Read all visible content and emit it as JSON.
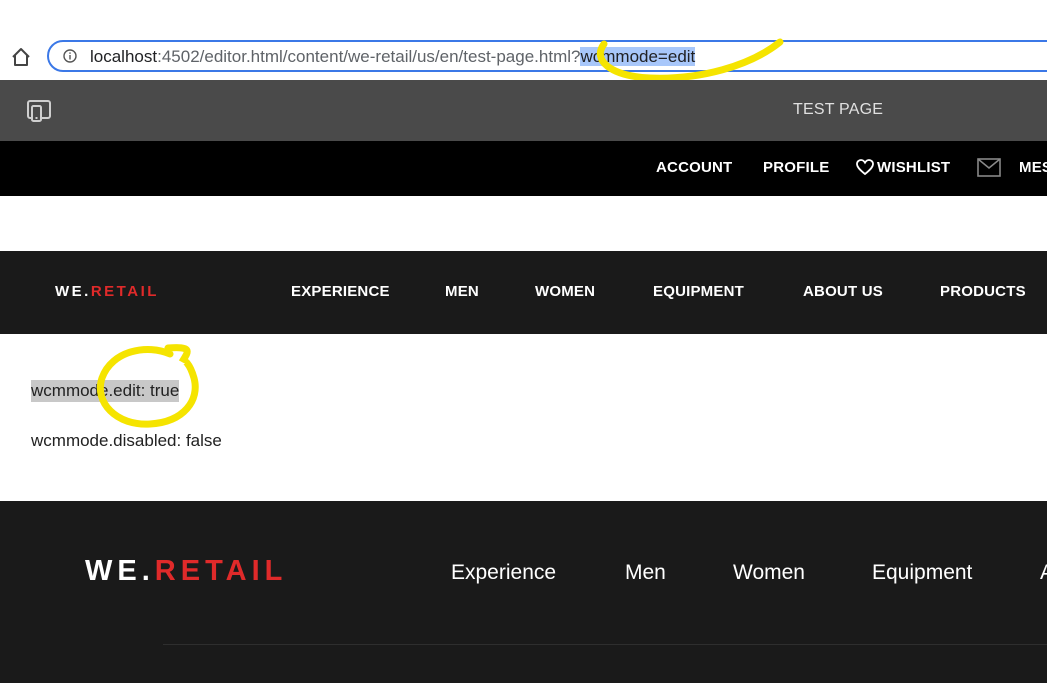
{
  "browser": {
    "url_host": "localhost",
    "url_port_path": ":4502/editor.html/content/we-retail/us/en/test-page.html?",
    "url_selected": "wcmmode=edit"
  },
  "editor": {
    "page_title": "TEST PAGE"
  },
  "account_bar": {
    "items": [
      {
        "label": "ACCOUNT"
      },
      {
        "label": "PROFILE"
      },
      {
        "label": "WISHLIST"
      },
      {
        "label": "MES"
      }
    ]
  },
  "main_nav": {
    "logo_prefix": "WE.",
    "logo_suffix": "RETAIL",
    "items": [
      {
        "label": "EXPERIENCE"
      },
      {
        "label": "MEN"
      },
      {
        "label": "WOMEN"
      },
      {
        "label": "EQUIPMENT"
      },
      {
        "label": "ABOUT US"
      },
      {
        "label": "PRODUCTS"
      }
    ]
  },
  "content": {
    "wcm_edit": "wcmmode.edit: true",
    "wcm_disabled": "wcmmode.disabled: false"
  },
  "footer": {
    "logo_prefix": "WE.",
    "logo_suffix": "RETAIL",
    "items": [
      {
        "label": "Experience"
      },
      {
        "label": "Men"
      },
      {
        "label": "Women"
      },
      {
        "label": "Equipment"
      },
      {
        "label": "A"
      }
    ]
  },
  "colors": {
    "brand_red": "#e02a2a",
    "nav_dark": "#1a1a1a",
    "editor_gray": "#4a4a4a",
    "highlighter_yellow": "#f5e400",
    "selection_blue": "#a8c7fa"
  },
  "icons": [
    "home-icon",
    "info-icon",
    "emulator-icon",
    "heart-icon",
    "mail-icon"
  ]
}
